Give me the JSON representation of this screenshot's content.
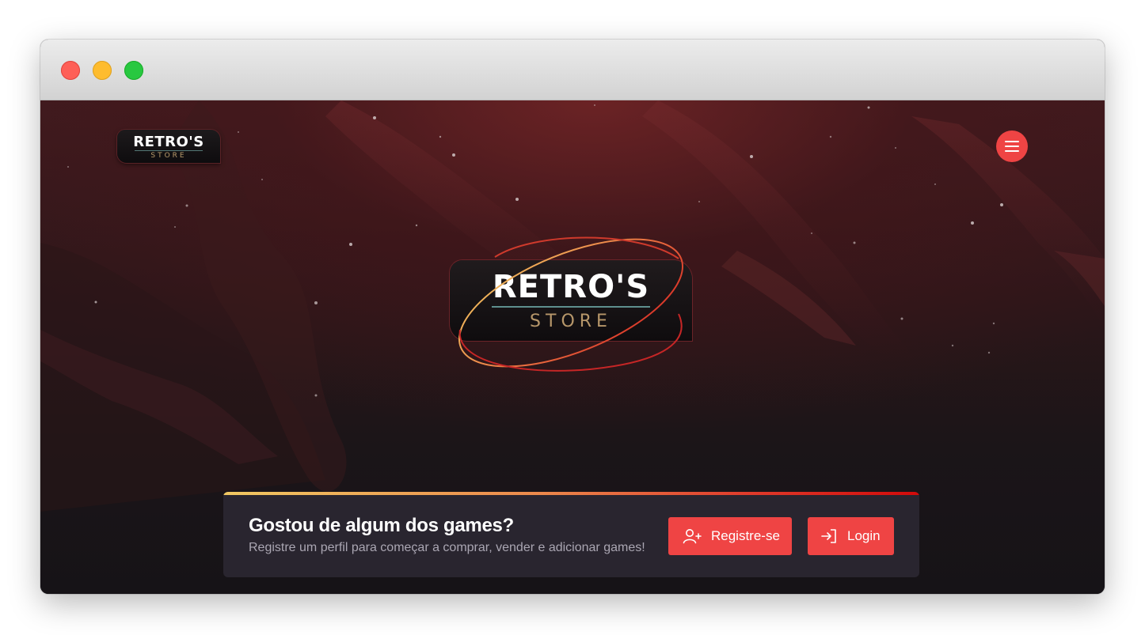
{
  "window": {
    "controls": [
      "close",
      "minimize",
      "maximize"
    ]
  },
  "header": {
    "logo": {
      "title": "RETRO'S",
      "subtitle": "STORE"
    },
    "menu_icon": "hamburger-menu-icon"
  },
  "hero": {
    "logo": {
      "title": "RETRO'S",
      "subtitle": "STORE"
    }
  },
  "cta": {
    "title": "Gostou de algum dos games?",
    "subtitle": "Registre um perfil para começar a comprar, vender e adicionar games!",
    "register_label": "Registre-se",
    "register_icon": "user-plus-icon",
    "login_label": "Login",
    "login_icon": "login-icon"
  },
  "colors": {
    "accent": "#ef4444",
    "panel": "#29252f",
    "gradient": [
      "#f1c862",
      "#ec8a4c",
      "#d10a0a"
    ]
  }
}
